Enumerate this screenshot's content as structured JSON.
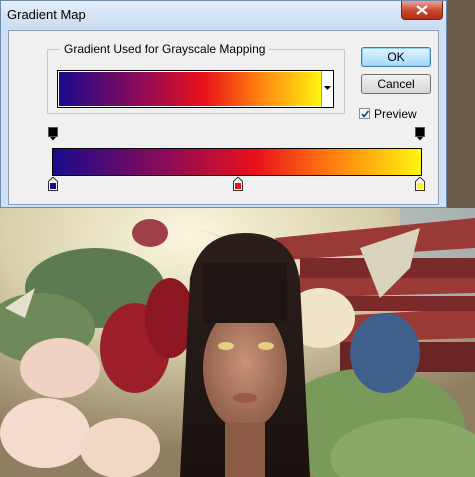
{
  "window": {
    "title": "Gradient Map"
  },
  "group": {
    "legend": "Gradient Used for Grayscale Mapping"
  },
  "buttons": {
    "ok": "OK",
    "cancel": "Cancel"
  },
  "preview": {
    "label": "Preview",
    "checked": true
  },
  "gradient": {
    "colors": [
      "#1a0a8c",
      "#8a0a5a",
      "#e8101a",
      "#ff7a10",
      "#fff510"
    ],
    "color_stops": [
      "#1a0a8c",
      "#e8101a",
      "#fff510"
    ],
    "opacity_stops": [
      "#000000",
      "#000000"
    ]
  },
  "photo": {
    "subject": "woman-with-orchids-pagoda-cranes"
  }
}
